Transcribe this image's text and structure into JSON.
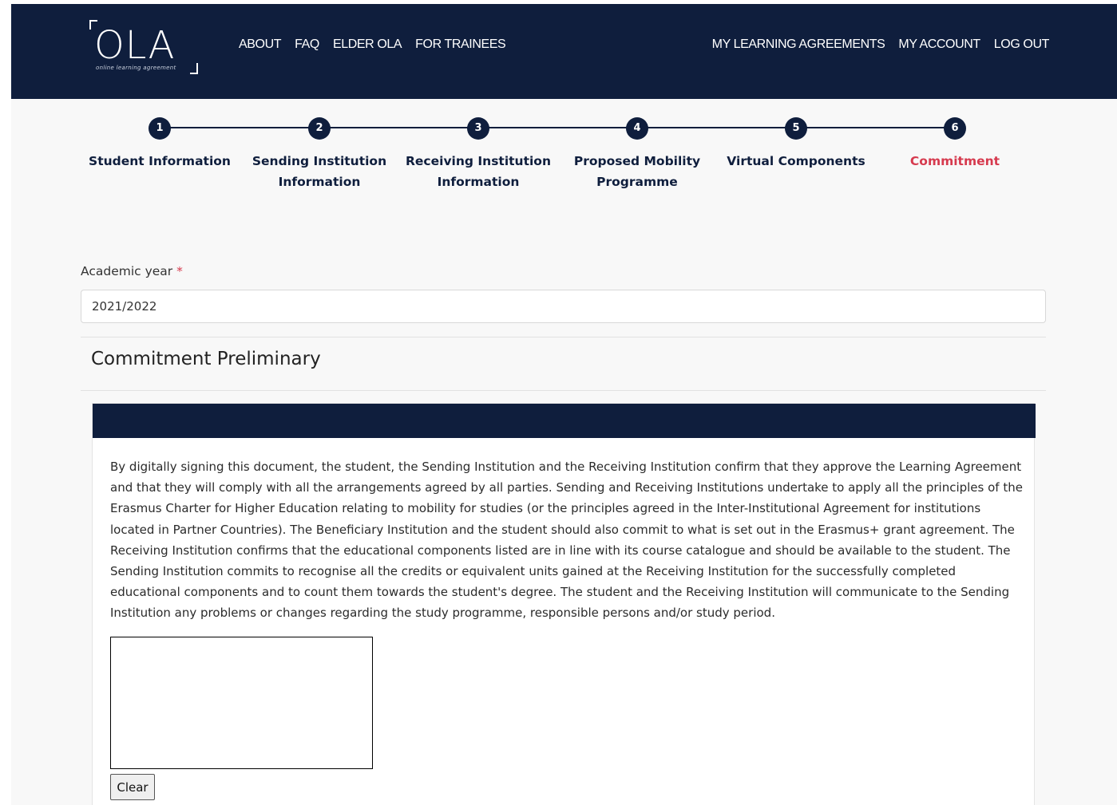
{
  "header": {
    "logo_text": "OLA",
    "logo_tagline": "online learning agreement",
    "nav_left": [
      "ABOUT",
      "FAQ",
      "ELDER OLA",
      "FOR TRAINEES"
    ],
    "nav_right": [
      "MY LEARNING AGREEMENTS",
      "MY ACCOUNT",
      "LOG OUT"
    ]
  },
  "stepper": {
    "steps": [
      {
        "number": "1",
        "label": "Student Information"
      },
      {
        "number": "2",
        "label": "Sending Institution Information"
      },
      {
        "number": "3",
        "label": "Receiving Institution Information"
      },
      {
        "number": "4",
        "label": "Proposed Mobility Programme"
      },
      {
        "number": "5",
        "label": "Virtual Components"
      },
      {
        "number": "6",
        "label": "Commitment"
      }
    ],
    "active_step": "6"
  },
  "form": {
    "academic_year_label": "Academic year",
    "required_marker": "*",
    "academic_year_value": "2021/2022"
  },
  "section": {
    "title": "Commitment Preliminary",
    "commitment_text": "By digitally signing this document, the student, the Sending Institution and the Receiving Institution confirm that they approve the Learning Agreement and that they will comply with all the arrangements agreed by all parties. Sending and Receiving Institutions undertake to apply all the principles of the Erasmus Charter for Higher Education relating to mobility for studies (or the principles agreed in the Inter-Institutional Agreement for institutions located in Partner Countries). The Beneficiary Institution and the student should also commit to what is set out in the Erasmus+ grant agreement. The Receiving Institution confirms that the educational components listed are in line with its course catalogue and should be available to the student. The Sending Institution commits to recognise all the credits or equivalent units gained at the Receiving Institution for the successfully completed educational components and to count them towards the student's degree. The student and the Receiving Institution will communicate to the Sending Institution any problems or changes regarding the study programme, responsible persons and/or study period.",
    "clear_button": "Clear"
  },
  "colors": {
    "navy": "#0f1e3d",
    "accent_red": "#d63a4e"
  }
}
